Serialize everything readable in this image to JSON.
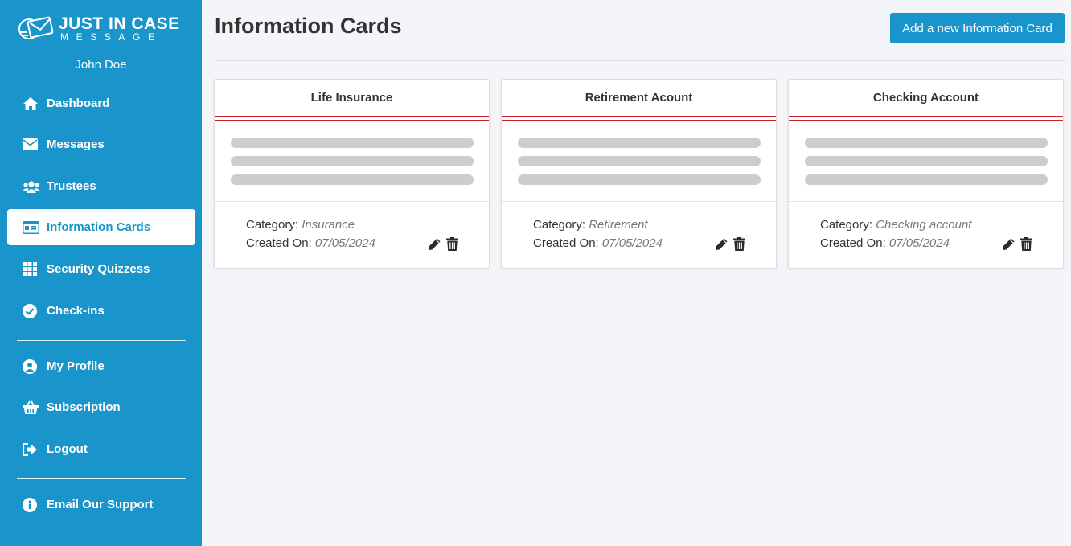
{
  "brand": {
    "line1": "JUST IN CASE",
    "line2": "MESSAGE"
  },
  "user": {
    "name": "John Doe"
  },
  "nav": {
    "dashboard": "Dashboard",
    "messages": "Messages",
    "trustees": "Trustees",
    "information_cards": "Information Cards",
    "security_quizzes": "Security Quizzess",
    "check_ins": "Check-ins",
    "my_profile": "My Profile",
    "subscription": "Subscription",
    "logout": "Logout",
    "email_support": "Email Our Support"
  },
  "page": {
    "title": "Information Cards",
    "add_button": "Add a new Information Card"
  },
  "labels": {
    "category": "Category:",
    "created_on": "Created On:"
  },
  "cards": [
    {
      "title": "Life Insurance",
      "category": "Insurance",
      "created_on": "07/05/2024"
    },
    {
      "title": "Retirement Acount",
      "category": "Retirement",
      "created_on": "07/05/2024"
    },
    {
      "title": "Checking Account",
      "category": "Checking account",
      "created_on": "07/05/2024"
    }
  ],
  "colors": {
    "primary": "#1a95cc",
    "accent_red": "#c0282d",
    "background": "#f4f5f9"
  }
}
